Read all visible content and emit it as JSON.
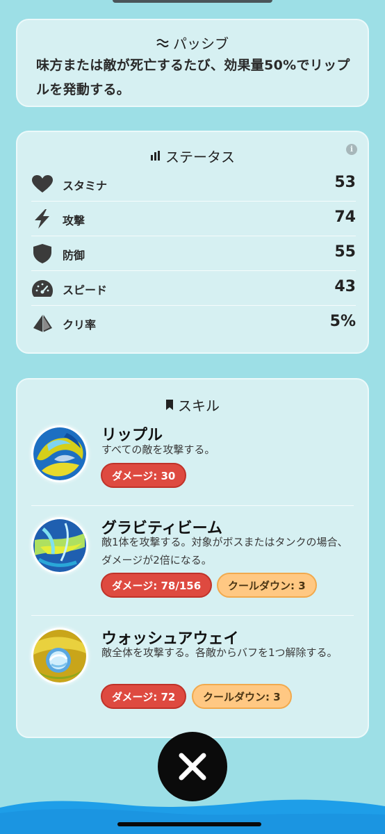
{
  "passive": {
    "title": "パッシブ",
    "description": "味方または敵が死亡するたび、効果量50%でリップルを発動する。"
  },
  "stats": {
    "title": "ステータス",
    "info_icon_glyph": "i",
    "items": [
      {
        "label": "スタミナ",
        "value": "53",
        "icon": "heart-icon"
      },
      {
        "label": "攻撃",
        "value": "74",
        "icon": "lightning-icon"
      },
      {
        "label": "防御",
        "value": "55",
        "icon": "shield-icon"
      },
      {
        "label": "スピード",
        "value": "43",
        "icon": "speedometer-icon"
      },
      {
        "label": "クリ率",
        "value": "5%",
        "icon": "crit-diamond-icon"
      }
    ]
  },
  "skills": {
    "title": "スキル",
    "items": [
      {
        "name": "リップル",
        "description": "すべての敵を攻撃する。",
        "damage": "ダメージ: 30"
      },
      {
        "name": "グラビティビーム",
        "description": "敵1体を攻撃する。対象がボスまたはタンクの場合、ダメージが2倍になる。",
        "damage": "ダメージ: 78/156",
        "cooldown": "クールダウン: 3"
      },
      {
        "name": "ウォッシュアウェイ",
        "description": "敵全体を攻撃する。各敵からバフを1つ解除する。",
        "damage": "ダメージ: 72",
        "cooldown": "クールダウン: 3"
      }
    ]
  },
  "colors": {
    "background": "#9ddfe6",
    "card": "#d6f0f2",
    "damage_badge": "#de4a40",
    "cooldown_badge": "#ffc883",
    "close_button": "#0b0b0b",
    "water": "#1e9ee8"
  }
}
